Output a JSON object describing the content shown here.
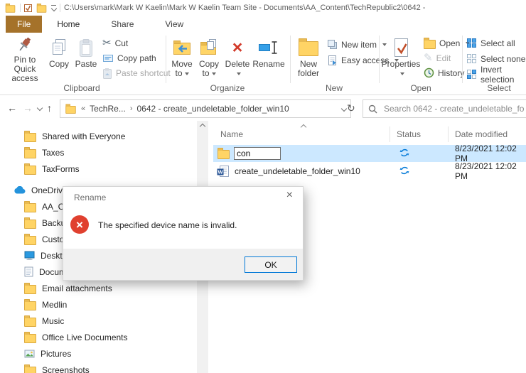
{
  "titlebar": {
    "path": "C:\\Users\\mark\\Mark W Kaelin\\Mark W Kaelin Team Site - Documents\\AA_Content\\TechRepublic2\\0642 -"
  },
  "tabs": {
    "file": "File",
    "home": "Home",
    "share": "Share",
    "view": "View"
  },
  "ribbon": {
    "clipboard": {
      "label": "Clipboard",
      "pin_line1": "Pin to Quick",
      "pin_line2": "access",
      "copy": "Copy",
      "paste": "Paste",
      "cut": "Cut",
      "copy_path": "Copy path",
      "paste_shortcut": "Paste shortcut"
    },
    "organize": {
      "label": "Organize",
      "move_line1": "Move",
      "move_line2": "to",
      "copy_line1": "Copy",
      "copy_line2": "to",
      "delete": "Delete",
      "rename": "Rename"
    },
    "new_group": {
      "label": "New",
      "new_folder_line1": "New",
      "new_folder_line2": "folder",
      "new_item": "New item",
      "easy_access": "Easy access"
    },
    "open_group": {
      "label": "Open",
      "properties": "Properties",
      "open": "Open",
      "edit": "Edit",
      "history": "History"
    },
    "select_group": {
      "label": "Select",
      "select_all": "Select all",
      "select_none": "Select none",
      "invert": "Invert selection"
    }
  },
  "navbar": {
    "breadcrumb_parent": "TechRe...",
    "breadcrumb_current": "0642 - create_undeletable_folder_win10",
    "search_placeholder": "Search 0642 - create_undeletable_fo"
  },
  "sidebar": {
    "items": [
      {
        "label": "Shared with Everyone",
        "icon": "folder"
      },
      {
        "label": "Taxes",
        "icon": "folder"
      },
      {
        "label": "TaxForms",
        "icon": "folder"
      },
      {
        "label": "OneDrive - Personal",
        "icon": "onedrive-cloud"
      },
      {
        "label": "AA_Content",
        "icon": "folder"
      },
      {
        "label": "Backup",
        "icon": "folder"
      },
      {
        "label": "Custom",
        "icon": "folder"
      },
      {
        "label": "Desktop",
        "icon": "desktop"
      },
      {
        "label": "Documents",
        "icon": "document"
      },
      {
        "label": "Email attachments",
        "icon": "folder"
      },
      {
        "label": "Medlin",
        "icon": "folder"
      },
      {
        "label": "Music",
        "icon": "folder"
      },
      {
        "label": "Office Live Documents",
        "icon": "folder"
      },
      {
        "label": "Pictures",
        "icon": "pictures"
      },
      {
        "label": "Screenshots",
        "icon": "folder"
      }
    ]
  },
  "filelist": {
    "columns": {
      "name": "Name",
      "status": "Status",
      "date": "Date modified"
    },
    "rows": [
      {
        "name": "con",
        "icon": "folder",
        "status_icon": "onedrive-sync",
        "date": "8/23/2021 12:02 PM",
        "editing": true
      },
      {
        "name": "create_undeletable_folder_win10",
        "icon": "word-doc",
        "status_icon": "onedrive-sync",
        "date": "8/23/2021 12:02 PM",
        "editing": false
      }
    ]
  },
  "dialog": {
    "title": "Rename",
    "message": "The specified device name is invalid.",
    "ok_label": "OK",
    "error_color": "#e0402f",
    "accent_color": "#0078d7"
  }
}
